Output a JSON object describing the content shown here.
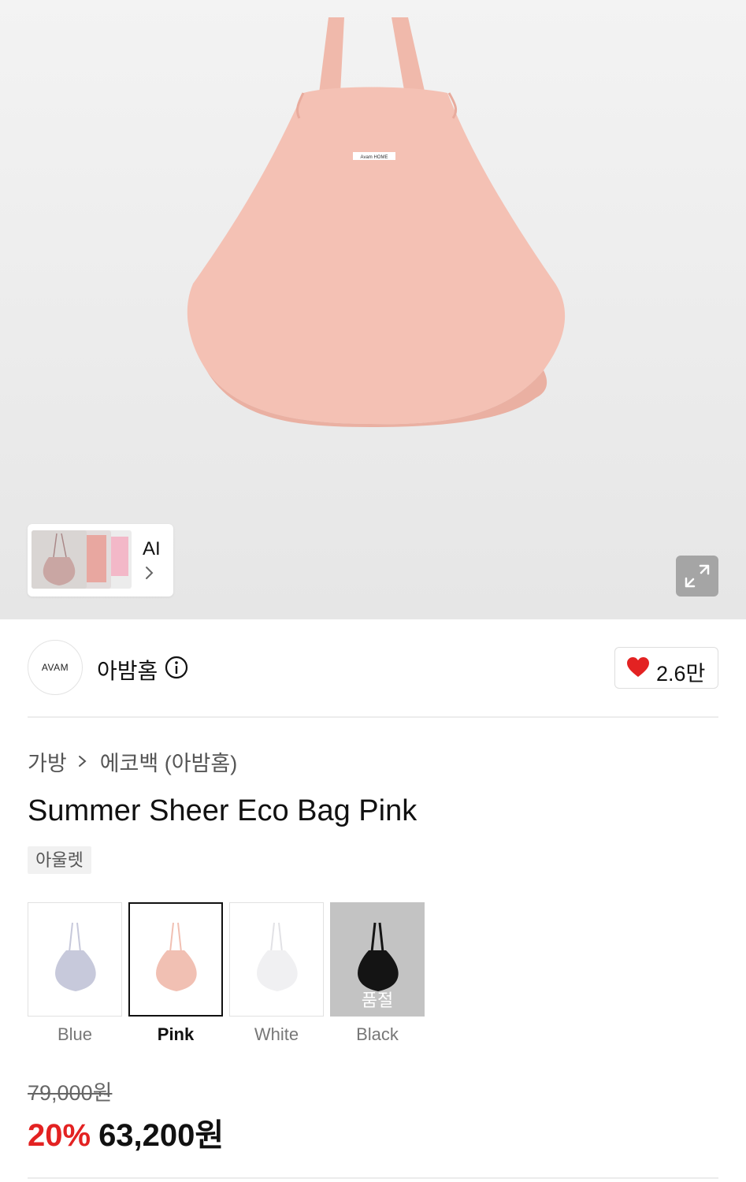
{
  "gallery": {
    "ai_label": "AI",
    "bag_color": "#f4c1b4",
    "bag_tag_text": "Avam HOME"
  },
  "brand": {
    "logo_text": "AVAM",
    "name": "아밤홈",
    "like_count": "2.6만",
    "like_color": "#e32222"
  },
  "breadcrumb": {
    "category": "가방",
    "subcategory": "에코백 (아밤홈)"
  },
  "product": {
    "title": "Summer Sheer Eco Bag Pink",
    "badge": "아울렛"
  },
  "options": [
    {
      "label": "Blue",
      "color": "#c7c9db",
      "selected": false,
      "soldout": false
    },
    {
      "label": "Pink",
      "color": "#f1c0b3",
      "selected": true,
      "soldout": false
    },
    {
      "label": "White",
      "color": "#f0f0f2",
      "selected": false,
      "soldout": false
    },
    {
      "label": "Black",
      "color": "#141414",
      "selected": false,
      "soldout": true,
      "soldout_text": "품절"
    }
  ],
  "price": {
    "original": "79,000원",
    "discount": "20%",
    "final": "63,200원",
    "discount_color": "#e32222"
  }
}
